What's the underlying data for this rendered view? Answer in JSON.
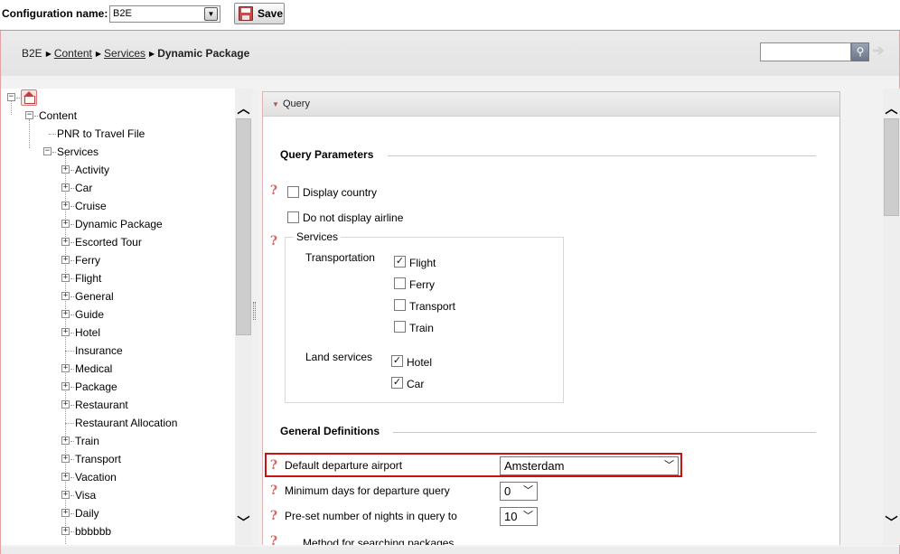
{
  "config": {
    "label": "Configuration name:",
    "selected": "B2E",
    "save_label": "Save"
  },
  "breadcrumb": {
    "root": "B2E",
    "link1": "Content",
    "link2": "Services",
    "current": "Dynamic Package"
  },
  "search": {
    "placeholder": ""
  },
  "tree": {
    "content": "Content",
    "pnr": "PNR to Travel File",
    "services": "Services",
    "items": [
      "Activity",
      "Car",
      "Cruise",
      "Dynamic Package",
      "Escorted Tour",
      "Ferry",
      "Flight",
      "General",
      "Guide",
      "Hotel",
      "Insurance",
      "Medical",
      "Package",
      "Restaurant",
      "Restaurant Allocation",
      "Train",
      "Transport",
      "Vacation",
      "Visa",
      "Daily",
      "bbbbbb"
    ]
  },
  "panel": {
    "header": "Query",
    "query_params_title": "Query Parameters",
    "display_country": "Display country",
    "no_airline": "Do not display airline",
    "services_legend": "Services",
    "transportation_label": "Transportation",
    "flight": "Flight",
    "ferry": "Ferry",
    "transport": "Transport",
    "train": "Train",
    "land_label": "Land services",
    "hotel": "Hotel",
    "car": "Car",
    "general_title": "General Definitions",
    "departure_label": "Default departure airport",
    "departure_value": "Amsterdam",
    "min_days_label": "Minimum days for departure query",
    "min_days_value": "0",
    "nights_label": "Pre-set number of nights in query to",
    "nights_value": "10",
    "cutoff_label": "Method for searching packages"
  },
  "icons": {
    "help": "question-icon",
    "accent": "#cc1111"
  }
}
